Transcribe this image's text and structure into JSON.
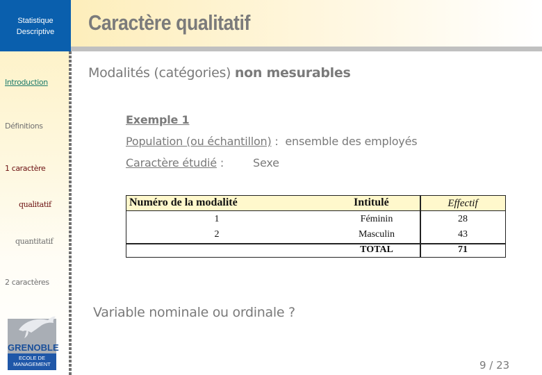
{
  "sidebar": {
    "course_title_line1": "Statistique",
    "course_title_line2": "Descriptive",
    "items": [
      {
        "label": "Introduction"
      },
      {
        "label": "Définitions"
      },
      {
        "label": "1 caractère"
      },
      {
        "label": "qualitatif"
      },
      {
        "label": "quantitatif"
      },
      {
        "label": "2 caractères"
      }
    ],
    "logo": {
      "name": "GRENOBLE",
      "sub_line1": "ECOLE DE",
      "sub_line2": "MANAGEMENT"
    }
  },
  "header": {
    "title": "Caractère qualitatif"
  },
  "content": {
    "subtitle_normal": "Modalités (catégories) ",
    "subtitle_bold": "non mesurables",
    "example_heading": "Exemple 1",
    "population_label": "Population (ou échantillon)",
    "population_sep": " :  ",
    "population_value": "ensemble des employés",
    "character_label": "Caractère étudié",
    "character_sep": " :",
    "character_value": "Sexe",
    "table": {
      "headers": [
        "Numéro de la modalité",
        "Intitulé",
        "Effectif"
      ],
      "rows": [
        [
          "1",
          "Féminin",
          "28"
        ],
        [
          "2",
          "Masculin",
          "43"
        ],
        [
          "",
          "TOTAL",
          "71"
        ]
      ]
    },
    "question": "Variable nominale ou ordinale ?"
  },
  "footer": {
    "page_indicator": "9 / 23"
  },
  "colors": {
    "sidebar_box": "#0a5fad",
    "active_nav": "#1a7a6a",
    "current_section": "#6b1010",
    "text_gray": "#7a7a7a",
    "table_header_bg": "#fff8cc"
  }
}
